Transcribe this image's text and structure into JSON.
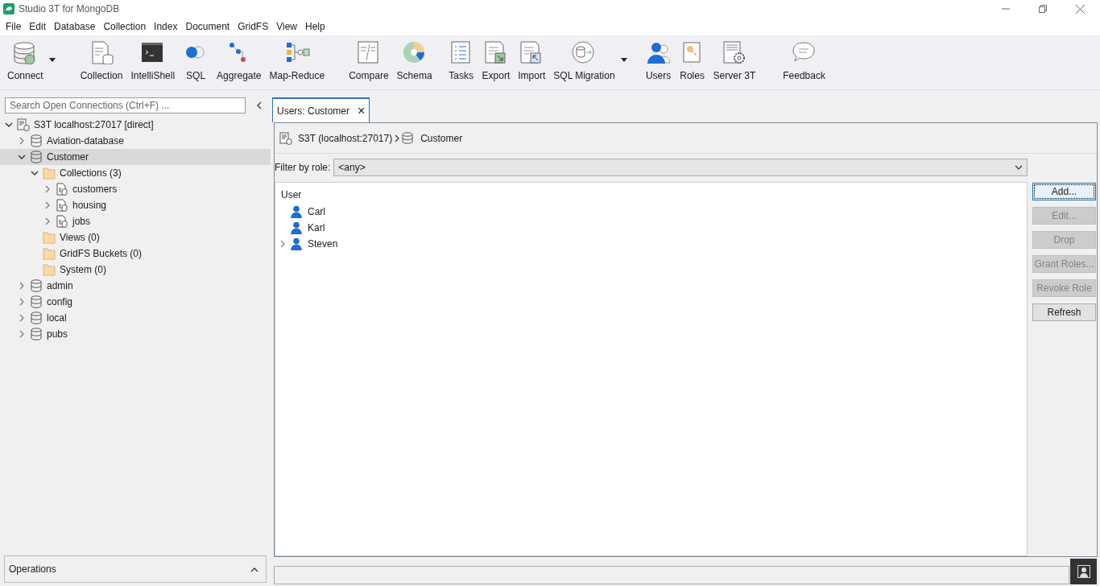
{
  "window": {
    "title": "Studio 3T for MongoDB"
  },
  "menu": [
    "File",
    "Edit",
    "Database",
    "Collection",
    "Index",
    "Document",
    "GridFS",
    "View",
    "Help"
  ],
  "toolbar": [
    {
      "label": "Connect",
      "dropdown": true
    },
    {
      "label": "Collection"
    },
    {
      "label": "IntelliShell"
    },
    {
      "label": "SQL"
    },
    {
      "label": "Aggregate"
    },
    {
      "label": "Map-Reduce"
    },
    {
      "label": "Compare"
    },
    {
      "label": "Schema"
    },
    {
      "label": "Tasks"
    },
    {
      "label": "Export"
    },
    {
      "label": "Import"
    },
    {
      "label": "SQL Migration",
      "dropdown": true
    },
    {
      "label": "Users"
    },
    {
      "label": "Roles"
    },
    {
      "label": "Server 3T"
    },
    {
      "label": "Feedback"
    }
  ],
  "sidebar": {
    "search": {
      "placeholder": "Search Open Connections (Ctrl+F) ..."
    },
    "tree": [
      {
        "label": "S3T localhost:27017 [direct]",
        "kind": "server",
        "expanded": true,
        "selected": false,
        "children": [
          {
            "label": "Aviation-database",
            "kind": "database",
            "expanded": false,
            "selected": false
          },
          {
            "label": "Customer",
            "kind": "database",
            "expanded": true,
            "selected": true,
            "children": [
              {
                "label": "Collections (3)",
                "kind": "folder",
                "expanded": true,
                "selected": false,
                "children": [
                  {
                    "label": "customers",
                    "kind": "collection",
                    "expanded": false,
                    "selected": false
                  },
                  {
                    "label": "housing",
                    "kind": "collection",
                    "expanded": false,
                    "selected": false
                  },
                  {
                    "label": "jobs",
                    "kind": "collection",
                    "expanded": false,
                    "selected": false
                  }
                ]
              },
              {
                "label": "Views (0)",
                "kind": "folder",
                "selected": false
              },
              {
                "label": "GridFS Buckets (0)",
                "kind": "folder",
                "selected": false
              },
              {
                "label": "System (0)",
                "kind": "folder",
                "selected": false
              }
            ]
          },
          {
            "label": "admin",
            "kind": "database",
            "expanded": false,
            "selected": false
          },
          {
            "label": "config",
            "kind": "database",
            "expanded": false,
            "selected": false
          },
          {
            "label": "local",
            "kind": "database",
            "expanded": false,
            "selected": false
          },
          {
            "label": "pubs",
            "kind": "database",
            "expanded": false,
            "selected": false
          }
        ]
      }
    ],
    "operations": {
      "title": "Operations"
    }
  },
  "tabs": [
    {
      "label": "Users: Customer",
      "selected": true,
      "close": "×"
    }
  ],
  "breadcrumb": {
    "server": "S3T (localhost:27017)",
    "database": "Customer"
  },
  "filter": {
    "label": "Filter by role:",
    "value": "<any>"
  },
  "users": {
    "column": "User",
    "rows": [
      {
        "name": "Carl"
      },
      {
        "name": "Karl"
      },
      {
        "name": "Steven",
        "expanded": false
      }
    ]
  },
  "buttons": [
    {
      "label": "Add...",
      "disabled": false,
      "focused": true
    },
    {
      "label": "Edit...",
      "disabled": true
    },
    {
      "label": "Drop",
      "disabled": true
    },
    {
      "label": "Grant Roles...",
      "disabled": true
    },
    {
      "label": "Revoke Role",
      "disabled": true
    },
    {
      "label": "Refresh",
      "disabled": false
    }
  ]
}
